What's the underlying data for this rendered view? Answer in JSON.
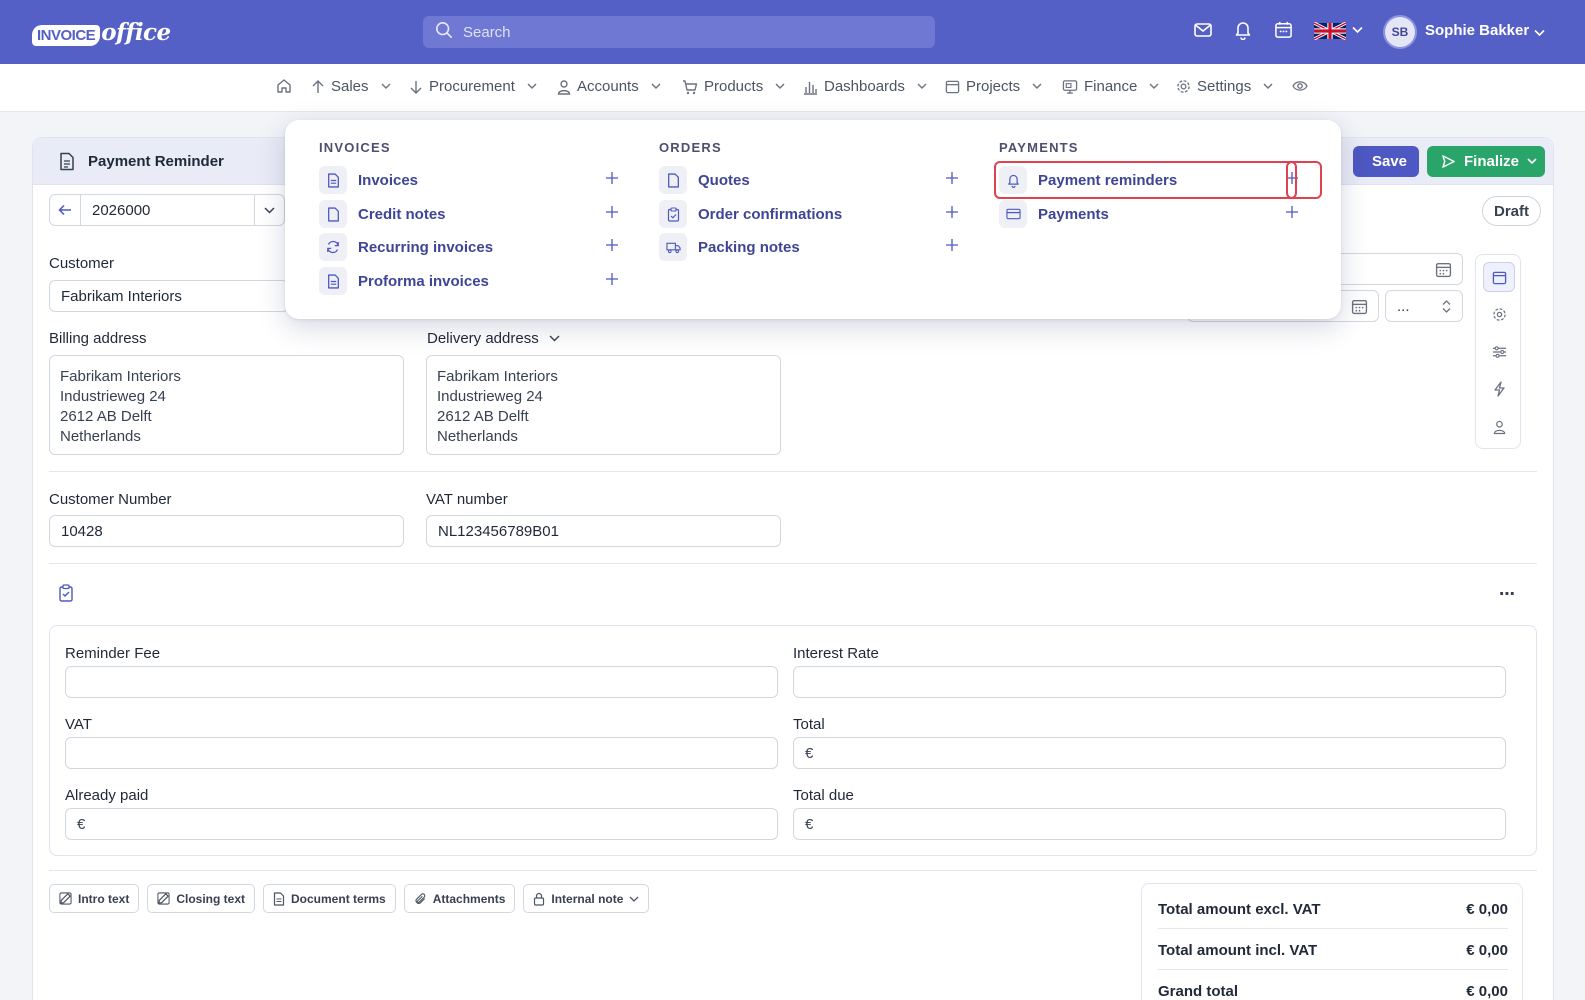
{
  "topbar": {
    "logo_badge": "INVOICE",
    "logo_word": "office",
    "search_placeholder": "Search",
    "user_initials": "SB",
    "user_name": "Sophie Bakker"
  },
  "nav": {
    "items": [
      {
        "label": "Sales"
      },
      {
        "label": "Procurement"
      },
      {
        "label": "Accounts"
      },
      {
        "label": "Products"
      },
      {
        "label": "Dashboards"
      },
      {
        "label": "Projects"
      },
      {
        "label": "Finance"
      },
      {
        "label": "Settings"
      }
    ]
  },
  "document": {
    "title": "Payment Reminder",
    "save_label": "Save",
    "finalize_label": "Finalize",
    "status": "Draft",
    "number": "2026000",
    "select_value": "..."
  },
  "form": {
    "customer_label": "Customer",
    "customer_value": "Fabrikam Interiors",
    "billing_label": "Billing address",
    "billing_lines": [
      "Fabrikam Interiors",
      "Industrieweg 24",
      "2612 AB Delft",
      "Netherlands"
    ],
    "delivery_label": "Delivery address",
    "delivery_lines": [
      "Fabrikam Interiors",
      "Industrieweg 24",
      "2612 AB Delft",
      "Netherlands"
    ],
    "customer_number_label": "Customer Number",
    "customer_number_value": "10428",
    "vat_number_label": "VAT number",
    "vat_number_value": "NL123456789B01"
  },
  "fees": {
    "reminder_fee_label": "Reminder Fee",
    "interest_rate_label": "Interest Rate",
    "vat_label": "VAT",
    "total_label": "Total",
    "already_paid_label": "Already paid",
    "total_due_label": "Total due",
    "currency_symbol": "€"
  },
  "chips": {
    "intro": "Intro text",
    "closing": "Closing text",
    "terms": "Document terms",
    "attachments": "Attachments",
    "internal": "Internal note"
  },
  "totals": {
    "excl_label": "Total amount excl. VAT",
    "excl_value": "€ 0,00",
    "incl_label": "Total amount incl. VAT",
    "incl_value": "€ 0,00",
    "grand_label": "Grand total",
    "grand_value": "€ 0,00"
  },
  "menu": {
    "invoices_head": "INVOICES",
    "orders_head": "ORDERS",
    "payments_head": "PAYMENTS",
    "invoices_items": [
      "Invoices",
      "Credit notes",
      "Recurring invoices",
      "Proforma invoices"
    ],
    "orders_items": [
      "Quotes",
      "Order confirmations",
      "Packing notes"
    ],
    "payments_items": [
      "Payment reminders",
      "Payments"
    ]
  },
  "colors": {
    "brand": "#5560c7",
    "finalize": "#2aa56a",
    "menu_link": "#3f4595",
    "highlight": "#e0414f"
  }
}
